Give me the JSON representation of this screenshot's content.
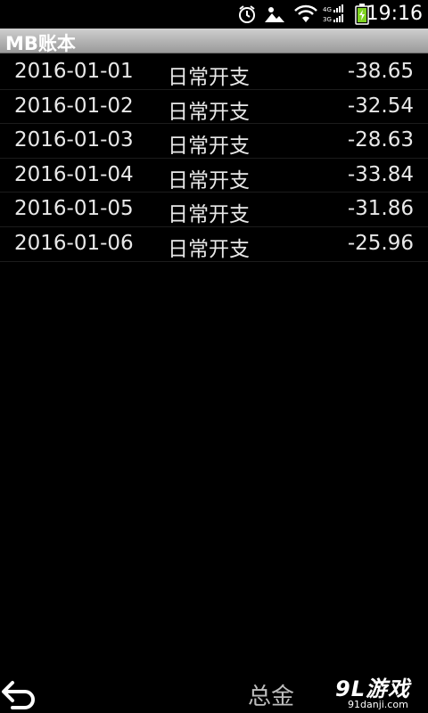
{
  "status_bar": {
    "time": "19:16",
    "network_labels": [
      "4G",
      "3G"
    ],
    "icons": [
      "alarm-icon",
      "weather-icon",
      "wifi-icon",
      "signal-icon",
      "battery-icon"
    ]
  },
  "app": {
    "title": "MB账本"
  },
  "entries": [
    {
      "date": "2016-01-01",
      "category": "日常开支",
      "amount": "-38.65"
    },
    {
      "date": "2016-01-02",
      "category": "日常开支",
      "amount": "-32.54"
    },
    {
      "date": "2016-01-03",
      "category": "日常开支",
      "amount": "-28.63"
    },
    {
      "date": "2016-01-04",
      "category": "日常开支",
      "amount": "-33.84"
    },
    {
      "date": "2016-01-05",
      "category": "日常开支",
      "amount": "-31.86"
    },
    {
      "date": "2016-01-06",
      "category": "日常开支",
      "amount": "-25.96"
    }
  ],
  "bottom_bar": {
    "back_icon": "back-arrow-icon",
    "total_label": "总金"
  },
  "watermark": {
    "logo": "9L游戏",
    "url": "91danji.com"
  },
  "colors": {
    "background": "#000000",
    "title_bar": "#b0b0b0",
    "battery": "#7ed321"
  }
}
